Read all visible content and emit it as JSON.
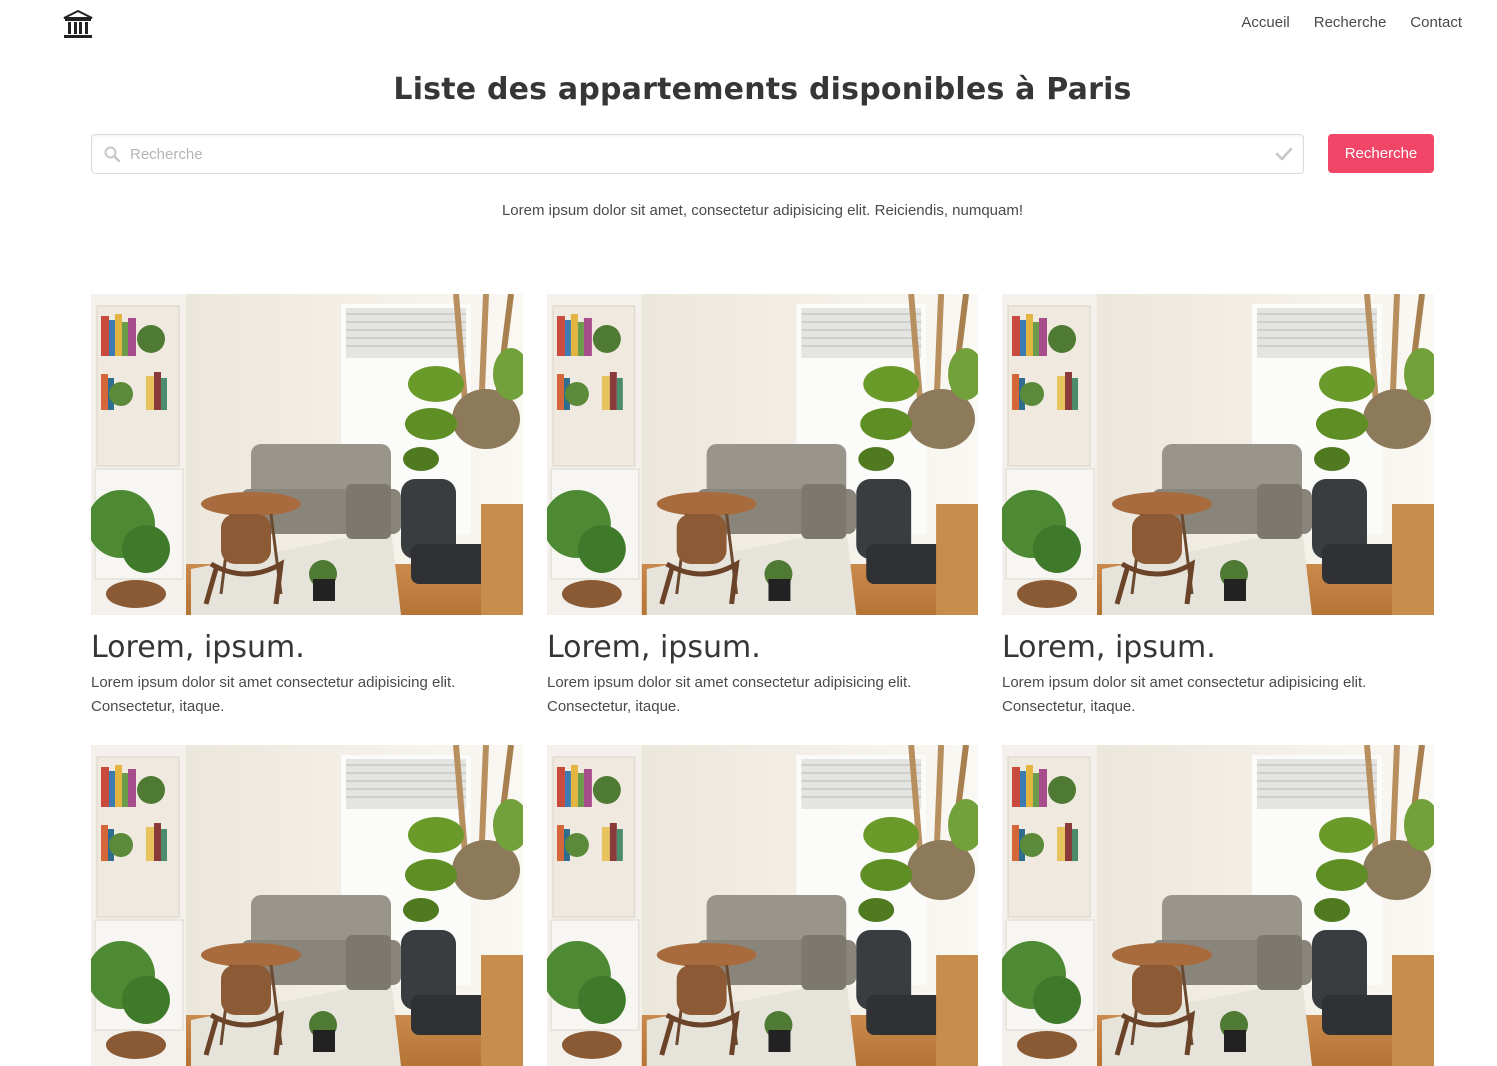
{
  "navbar": {
    "logo_icon": "museum-building-icon",
    "links": [
      {
        "label": "Accueil"
      },
      {
        "label": "Recherche"
      },
      {
        "label": "Contact"
      }
    ]
  },
  "header": {
    "title": "Liste des appartements disponibles à Paris"
  },
  "search": {
    "placeholder": "Recherche",
    "value": "",
    "button_label": "Recherche",
    "button_color": "#f14668",
    "left_icon": "search-icon",
    "right_icon": "check-icon"
  },
  "intro": {
    "text": "Lorem ipsum dolor sit amet, consectetur adipisicing elit. Reiciendis, numquam!"
  },
  "listings": [
    {
      "title": "Lorem, ipsum.",
      "description": "Lorem ipsum dolor sit amet consectetur adipisicing elit. Consectetur, itaque.",
      "image": "living-room-photo"
    },
    {
      "title": "Lorem, ipsum.",
      "description": "Lorem ipsum dolor sit amet consectetur adipisicing elit. Consectetur, itaque.",
      "image": "living-room-photo"
    },
    {
      "title": "Lorem, ipsum.",
      "description": "Lorem ipsum dolor sit amet consectetur adipisicing elit. Consectetur, itaque.",
      "image": "living-room-photo"
    },
    {
      "title": "",
      "description": "",
      "image": "living-room-photo"
    },
    {
      "title": "",
      "description": "",
      "image": "living-room-photo"
    },
    {
      "title": "",
      "description": "",
      "image": "living-room-photo"
    }
  ]
}
